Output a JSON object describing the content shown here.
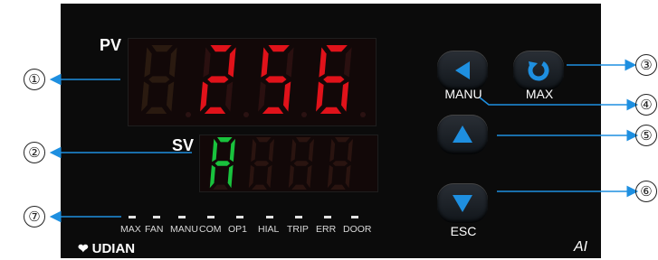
{
  "panel": {
    "pv_label": "PV",
    "sv_label": "SV",
    "pv_display": "256",
    "sv_display": "A",
    "brand": "UDIAN",
    "model": "AI"
  },
  "buttons": [
    {
      "icon": "arrow-left-icon",
      "caption": "MANU"
    },
    {
      "icon": "refresh-icon",
      "caption": "MAX"
    },
    {
      "icon": "arrow-up-icon",
      "caption": ""
    },
    {
      "icon": "arrow-down-icon",
      "caption": "ESC"
    }
  ],
  "indicators": [
    "MAX",
    "FAN",
    "MANU",
    "COM",
    "OP1",
    "HIAL",
    "TRIP",
    "ERR",
    "DOOR"
  ],
  "callouts": [
    "①",
    "②",
    "③",
    "④",
    "⑤",
    "⑥",
    "⑦"
  ],
  "colors": {
    "pv_segment": "#e0121a",
    "sv_segment": "#19c23d",
    "button_accent": "#1e8fe0",
    "panel_bg": "#0b0b0b"
  }
}
